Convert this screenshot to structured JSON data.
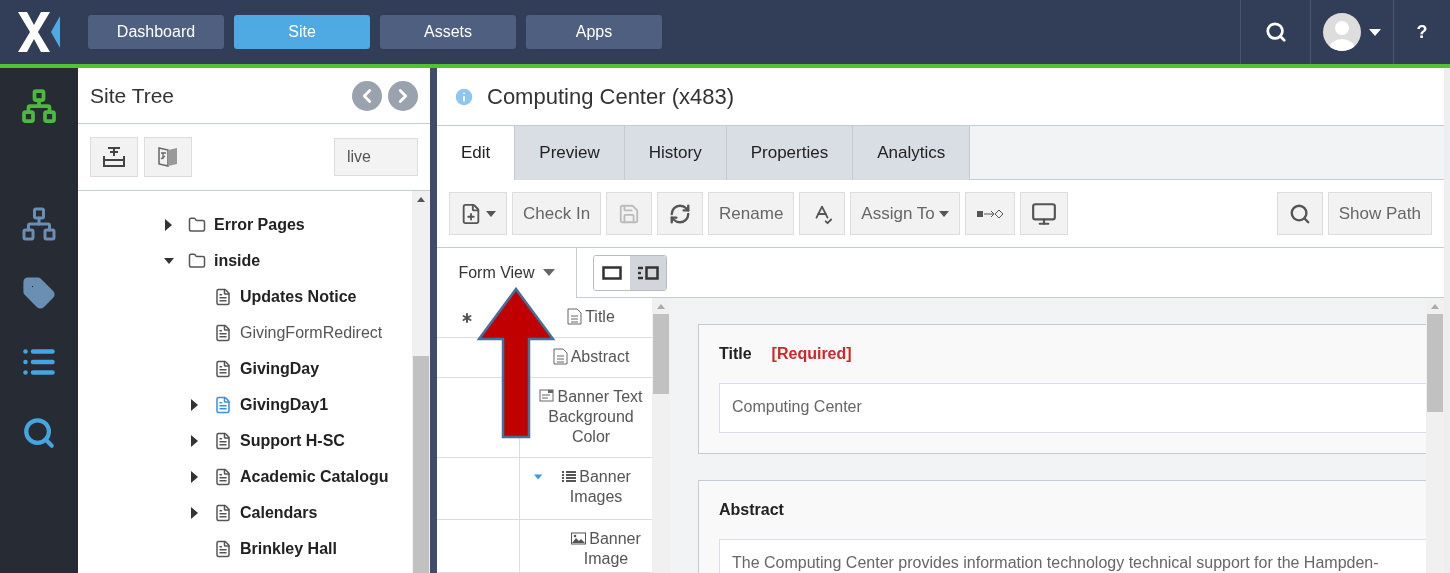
{
  "nav": {
    "tabs": [
      {
        "label": "Dashboard",
        "selected": false
      },
      {
        "label": "Site",
        "selected": true
      },
      {
        "label": "Assets",
        "selected": false
      },
      {
        "label": "Apps",
        "selected": false
      }
    ],
    "help": "?"
  },
  "site_tree": {
    "title": "Site Tree",
    "branch": "live",
    "items": [
      {
        "label": "Error Pages",
        "kind": "folder",
        "expanded": false,
        "published": true,
        "highlighted": false
      },
      {
        "label": "inside",
        "kind": "folder",
        "expanded": true,
        "published": true,
        "highlighted": false,
        "children": [
          {
            "label": "Updates Notice",
            "kind": "page",
            "published": true,
            "highlighted": false
          },
          {
            "label": "GivingFormRedirect",
            "kind": "page",
            "published": false,
            "highlighted": false
          },
          {
            "label": "GivingDay",
            "kind": "page",
            "published": true,
            "highlighted": false
          },
          {
            "label": "GivingDay1",
            "kind": "page",
            "expanded": false,
            "published": true,
            "highlighted": true
          },
          {
            "label": "Support H-SC",
            "kind": "page",
            "expanded": false,
            "published": true,
            "highlighted": false
          },
          {
            "label": "Academic Catalogu",
            "kind": "page",
            "expanded": false,
            "published": true,
            "highlighted": false
          },
          {
            "label": "Calendars",
            "kind": "page",
            "expanded": false,
            "published": true,
            "highlighted": false
          },
          {
            "label": "Brinkley Hall",
            "kind": "page",
            "published": true,
            "highlighted": false
          }
        ]
      }
    ]
  },
  "content": {
    "title": "Computing Center (x483)",
    "tabs": [
      {
        "label": "Edit",
        "selected": true
      },
      {
        "label": "Preview",
        "selected": false
      },
      {
        "label": "History",
        "selected": false
      },
      {
        "label": "Properties",
        "selected": false
      },
      {
        "label": "Analytics",
        "selected": false
      }
    ],
    "toolbar": [
      {
        "kind": "new",
        "disabled": false
      },
      {
        "kind": "text",
        "label": "Check In",
        "disabled": false
      },
      {
        "kind": "save",
        "disabled": true
      },
      {
        "kind": "refresh",
        "disabled": false
      },
      {
        "kind": "text",
        "label": "Rename",
        "disabled": false
      },
      {
        "kind": "spellcheck",
        "disabled": false
      },
      {
        "kind": "menu",
        "label": "Assign To",
        "disabled": false
      },
      {
        "kind": "link",
        "disabled": false
      },
      {
        "kind": "preview",
        "disabled": false
      }
    ],
    "toolbar_right": [
      {
        "kind": "search",
        "disabled": false
      },
      {
        "kind": "text",
        "label": "Show Path",
        "disabled": false
      }
    ],
    "view": {
      "mode": "Form View",
      "layouts": [
        {
          "kind": "single",
          "selected": false
        },
        {
          "kind": "split",
          "selected": true
        }
      ]
    },
    "outline": [
      {
        "label": "Title",
        "kind": "text",
        "required": true
      },
      {
        "label": "Abstract",
        "kind": "text",
        "required": false
      },
      {
        "label": "Banner Text Background Color",
        "kind": "option",
        "required": false
      },
      {
        "label": "Banner Images",
        "kind": "group",
        "required": false,
        "expanded": true,
        "children": [
          {
            "label": "Banner Image",
            "kind": "image",
            "required": false
          }
        ]
      }
    ],
    "fields": [
      {
        "label": "Title",
        "required": true,
        "required_label": "[Required]",
        "value": "Computing Center"
      },
      {
        "label": "Abstract",
        "required": false,
        "value": "The Computing Center provides information technology technical support for the Hampden-"
      }
    ]
  }
}
